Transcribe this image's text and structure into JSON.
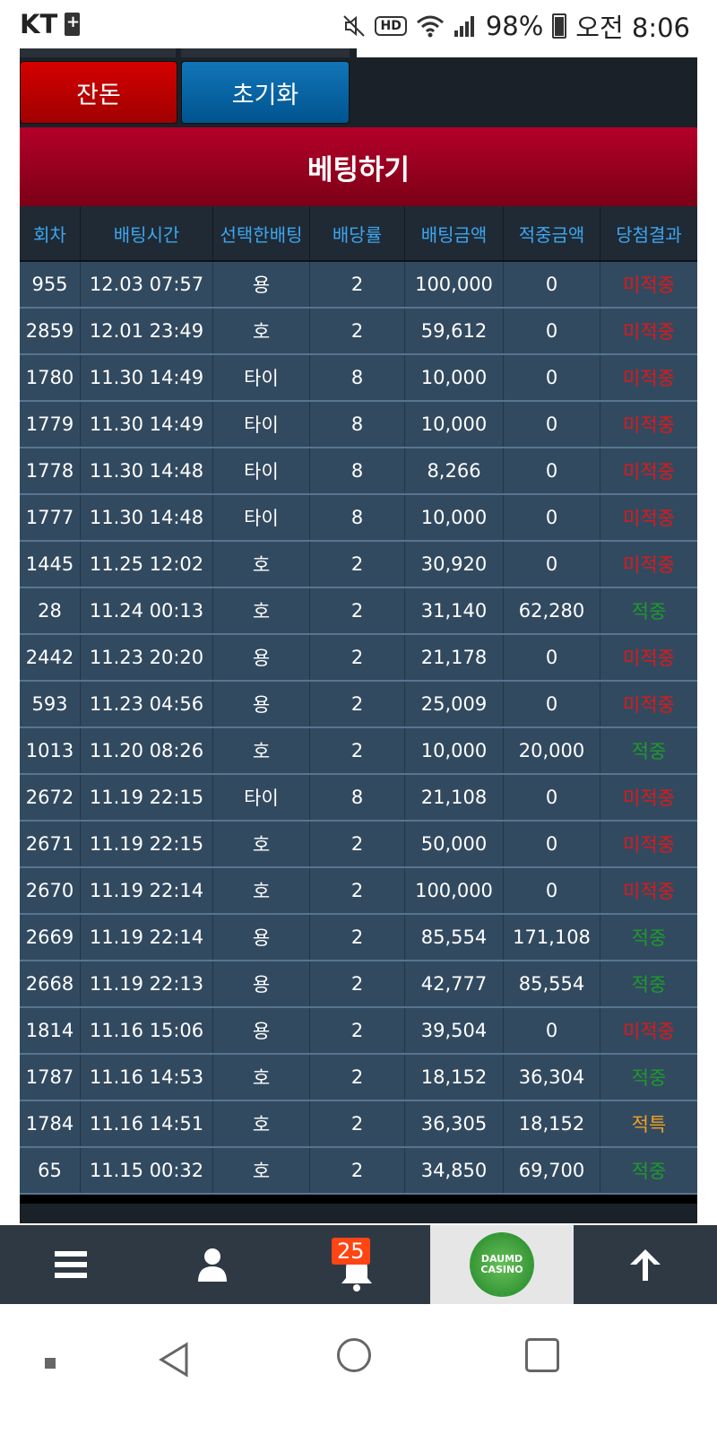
{
  "status_bar": {
    "carrier": "KT",
    "battery_percent": "98%",
    "time": "오전 8:06",
    "icons": [
      "sim-icon",
      "mute-icon",
      "hd-icon",
      "wifi-icon",
      "signal-icon",
      "battery-icon"
    ]
  },
  "buttons": {
    "balance": "잔돈",
    "reset": "초기화"
  },
  "bet_title": "베팅하기",
  "table": {
    "headers": [
      "회차",
      "배팅시간",
      "선택한배팅",
      "배당률",
      "배팅금액",
      "적중금액",
      "당첨결과"
    ],
    "rows": [
      {
        "round": "955",
        "time": "12.03 07:57",
        "pick": "용",
        "odds": "2",
        "amount": "100,000",
        "win": "0",
        "result": "미적중",
        "status": "lose"
      },
      {
        "round": "2859",
        "time": "12.01 23:49",
        "pick": "호",
        "odds": "2",
        "amount": "59,612",
        "win": "0",
        "result": "미적중",
        "status": "lose"
      },
      {
        "round": "1780",
        "time": "11.30 14:49",
        "pick": "타이",
        "odds": "8",
        "amount": "10,000",
        "win": "0",
        "result": "미적중",
        "status": "lose"
      },
      {
        "round": "1779",
        "time": "11.30 14:49",
        "pick": "타이",
        "odds": "8",
        "amount": "10,000",
        "win": "0",
        "result": "미적중",
        "status": "lose"
      },
      {
        "round": "1778",
        "time": "11.30 14:48",
        "pick": "타이",
        "odds": "8",
        "amount": "8,266",
        "win": "0",
        "result": "미적중",
        "status": "lose"
      },
      {
        "round": "1777",
        "time": "11.30 14:48",
        "pick": "타이",
        "odds": "8",
        "amount": "10,000",
        "win": "0",
        "result": "미적중",
        "status": "lose"
      },
      {
        "round": "1445",
        "time": "11.25 12:02",
        "pick": "호",
        "odds": "2",
        "amount": "30,920",
        "win": "0",
        "result": "미적중",
        "status": "lose"
      },
      {
        "round": "28",
        "time": "11.24 00:13",
        "pick": "호",
        "odds": "2",
        "amount": "31,140",
        "win": "62,280",
        "result": "적중",
        "status": "win"
      },
      {
        "round": "2442",
        "time": "11.23 20:20",
        "pick": "용",
        "odds": "2",
        "amount": "21,178",
        "win": "0",
        "result": "미적중",
        "status": "lose"
      },
      {
        "round": "593",
        "time": "11.23 04:56",
        "pick": "용",
        "odds": "2",
        "amount": "25,009",
        "win": "0",
        "result": "미적중",
        "status": "lose"
      },
      {
        "round": "1013",
        "time": "11.20 08:26",
        "pick": "호",
        "odds": "2",
        "amount": "10,000",
        "win": "20,000",
        "result": "적중",
        "status": "win"
      },
      {
        "round": "2672",
        "time": "11.19 22:15",
        "pick": "타이",
        "odds": "8",
        "amount": "21,108",
        "win": "0",
        "result": "미적중",
        "status": "lose"
      },
      {
        "round": "2671",
        "time": "11.19 22:15",
        "pick": "호",
        "odds": "2",
        "amount": "50,000",
        "win": "0",
        "result": "미적중",
        "status": "lose"
      },
      {
        "round": "2670",
        "time": "11.19 22:14",
        "pick": "호",
        "odds": "2",
        "amount": "100,000",
        "win": "0",
        "result": "미적중",
        "status": "lose"
      },
      {
        "round": "2669",
        "time": "11.19 22:14",
        "pick": "용",
        "odds": "2",
        "amount": "85,554",
        "win": "171,108",
        "result": "적중",
        "status": "win"
      },
      {
        "round": "2668",
        "time": "11.19 22:13",
        "pick": "용",
        "odds": "2",
        "amount": "42,777",
        "win": "85,554",
        "result": "적중",
        "status": "win"
      },
      {
        "round": "1814",
        "time": "11.16 15:06",
        "pick": "용",
        "odds": "2",
        "amount": "39,504",
        "win": "0",
        "result": "미적중",
        "status": "lose"
      },
      {
        "round": "1787",
        "time": "11.16 14:53",
        "pick": "호",
        "odds": "2",
        "amount": "18,152",
        "win": "36,304",
        "result": "적중",
        "status": "win"
      },
      {
        "round": "1784",
        "time": "11.16 14:51",
        "pick": "호",
        "odds": "2",
        "amount": "36,305",
        "win": "18,152",
        "result": "적특",
        "status": "special"
      },
      {
        "round": "65",
        "time": "11.15 00:32",
        "pick": "호",
        "odds": "2",
        "amount": "34,850",
        "win": "69,700",
        "result": "적중",
        "status": "win"
      }
    ]
  },
  "app_nav": {
    "notification_count": "25",
    "logo_text": [
      "DAUMD",
      "CASINO"
    ],
    "icons": [
      "menu-icon",
      "user-icon",
      "bell-icon",
      "casino-logo",
      "arrow-up-icon"
    ]
  },
  "colors": {
    "lose": "#e01818",
    "win": "#1e9a2b",
    "special": "#f0a023",
    "header_text": "#3ea6ee",
    "row_bg": "#324a60"
  }
}
